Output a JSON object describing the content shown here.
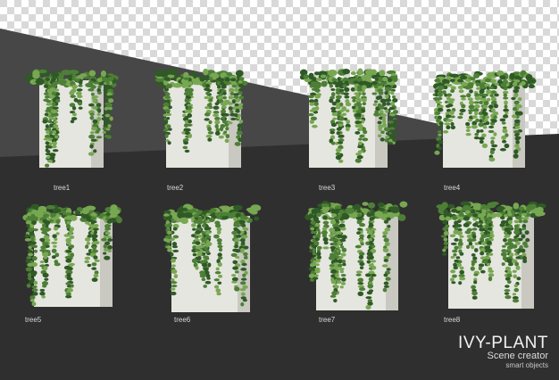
{
  "colors": {
    "checker_light": "#ffffff",
    "checker_dark": "#d9d9d9",
    "band_upper": "#474747",
    "band_lower": "#2f2f2f",
    "stone": "#e6e6e0",
    "stone_shade": "#c9c9c2",
    "leaf_dark": "#2f5a26",
    "leaf_mid": "#4d7f36",
    "leaf_light": "#78a752"
  },
  "items": [
    {
      "label": "tree1"
    },
    {
      "label": "tree2"
    },
    {
      "label": "tree3"
    },
    {
      "label": "tree4"
    },
    {
      "label": "tree5"
    },
    {
      "label": "tree6"
    },
    {
      "label": "tree7"
    },
    {
      "label": "tree8"
    }
  ],
  "title": {
    "main": "IVY-PLANT",
    "sub": "Scene creator",
    "sub2": "smart objects"
  }
}
